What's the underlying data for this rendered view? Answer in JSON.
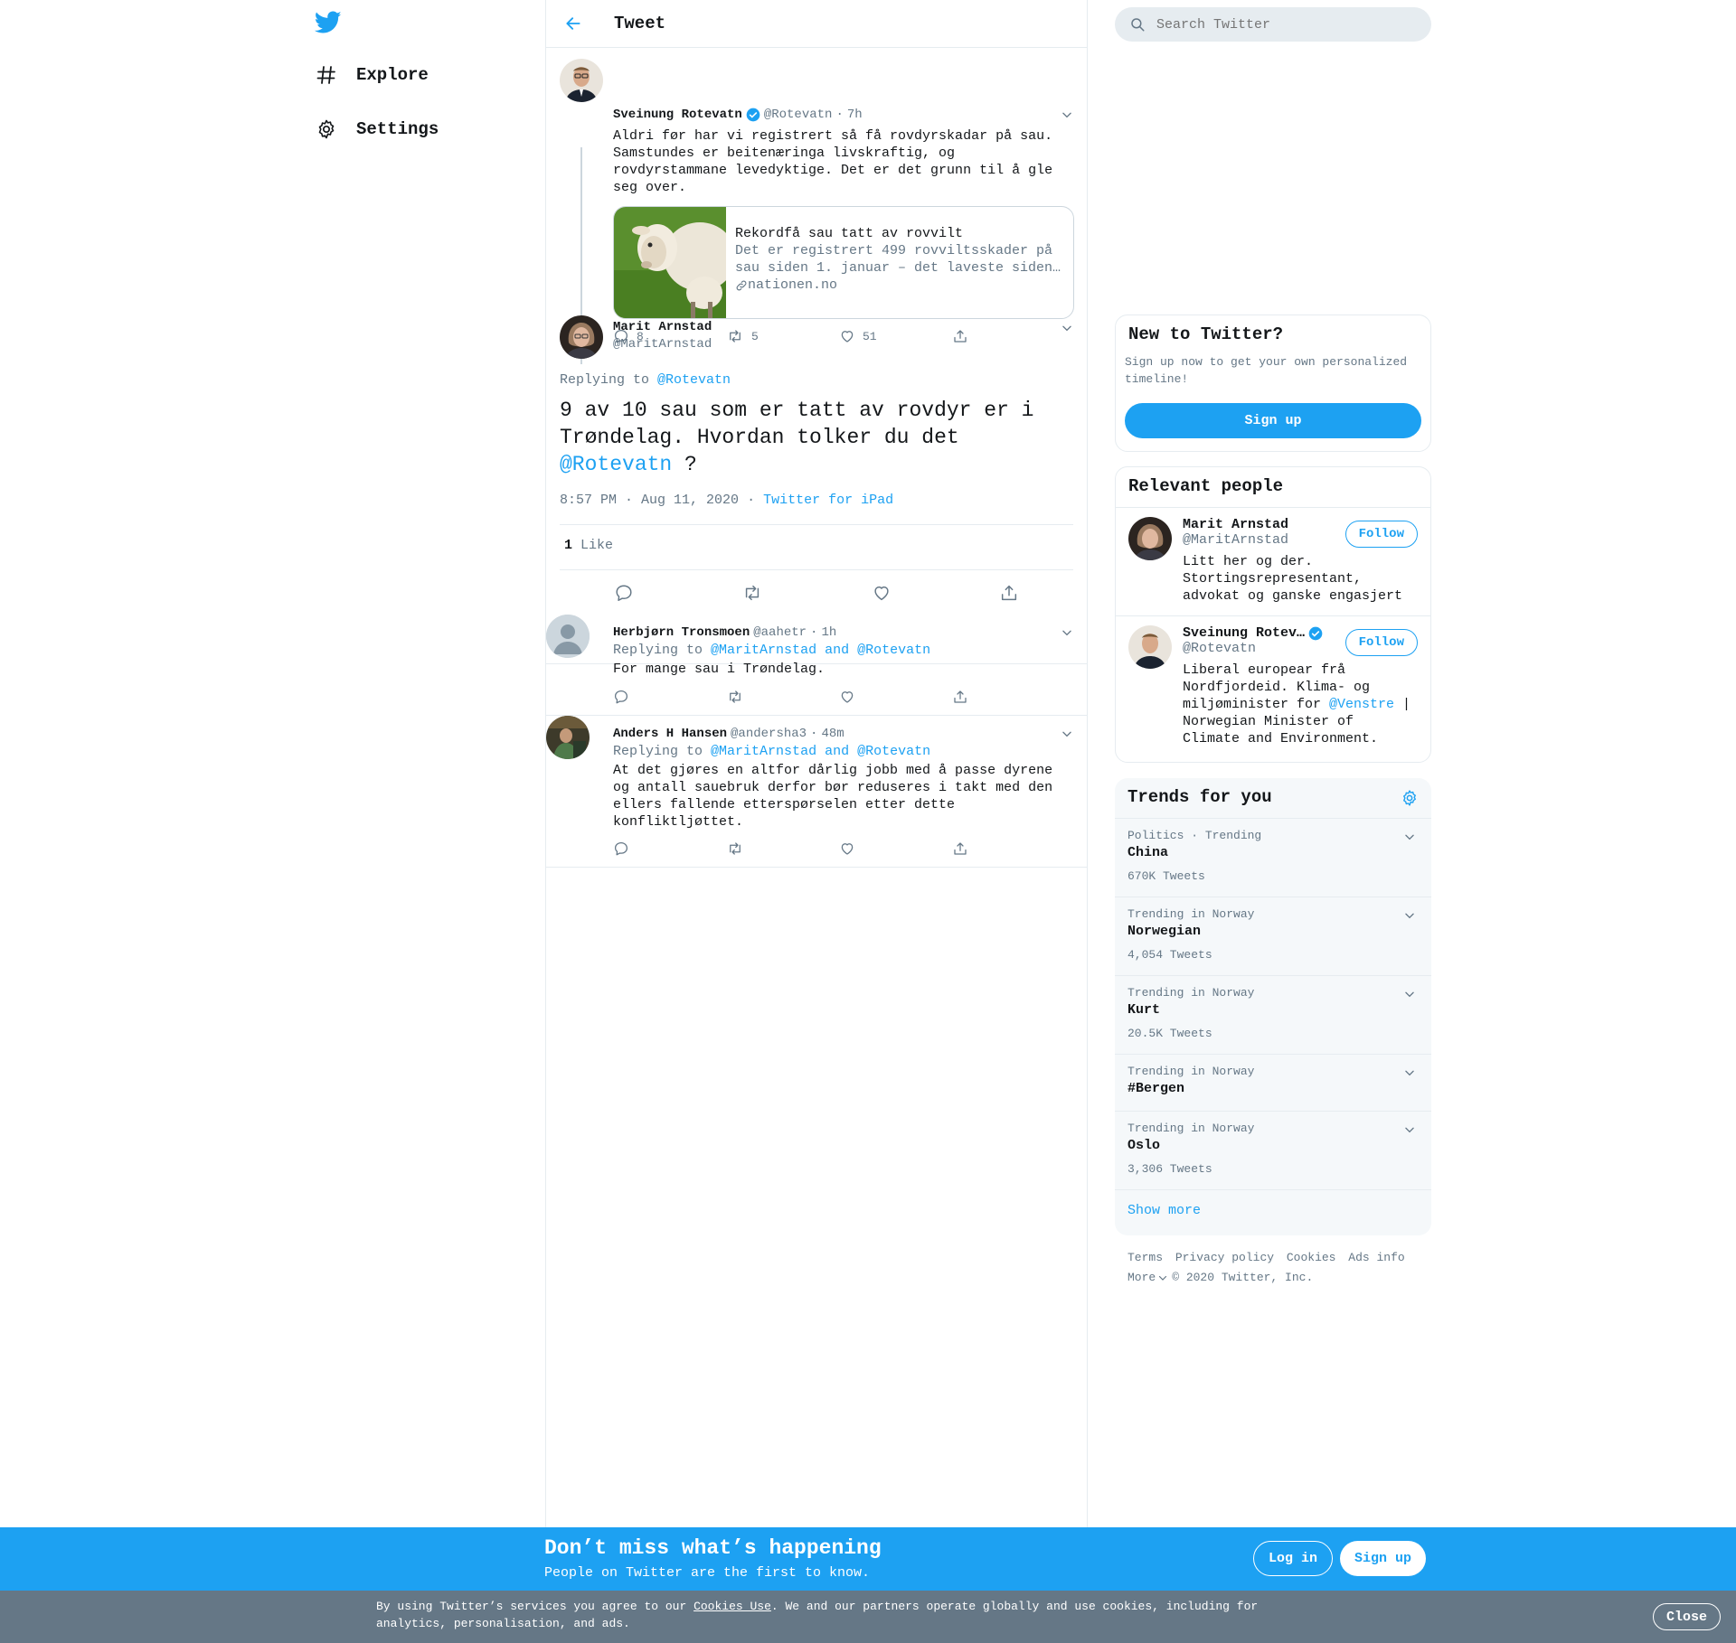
{
  "colors": {
    "accent": "#1da1f2",
    "muted": "#657786",
    "text": "#14171a",
    "border": "#e6ecf0",
    "cookie_bar": "#657786"
  },
  "nav": {
    "logo_icon": "twitter-bird-icon",
    "items": [
      {
        "label": "Explore",
        "icon": "hashtag-icon"
      },
      {
        "label": "Settings",
        "icon": "gear-icon"
      }
    ]
  },
  "header": {
    "title": "Tweet"
  },
  "parent_tweet": {
    "name": "Sveinung Rotevatn",
    "handle": "@Rotevatn",
    "separator": "·",
    "time": "7h",
    "text": "Aldri før har vi registrert så få rovdyrskadar på sau.\nSamstundes er beitenæringa livskraftig, og\nrovdyrstammane levedyktige. Det er det grunn til å gle\nseg over.",
    "card": {
      "title": "Rekordfå sau tatt av rovvilt",
      "description": "Det er registrert 499 rovviltsskader på\nsau siden 1. januar – det laveste siden…",
      "domain": "nationen.no"
    },
    "replies": "8",
    "retweets": "5",
    "likes": "51"
  },
  "focal_tweet": {
    "name": "Marit Arnstad",
    "handle": "@MaritArnstad",
    "replying_label": "Replying to",
    "replying_to": "@Rotevatn",
    "text_before": "9 av 10 sau som er tatt av rovdyr er i\nTrøndelag. Hvordan tolker du det\n",
    "mention": "@Rotevatn",
    "text_after": " ?",
    "time": "8:57 PM · Aug 11, 2020",
    "separator": "·",
    "source": "Twitter for iPad",
    "like_count": "1",
    "like_label": "Like"
  },
  "replies": [
    {
      "name": "Herbjørn Tronsmoen",
      "handle": "@aahetr",
      "separator": "·",
      "time": "1h",
      "replying_label": "Replying to",
      "replying_to": "@MaritArnstad and @Rotevatn",
      "text": "For mange sau i Trøndelag."
    },
    {
      "name": "Anders H Hansen",
      "handle": "@andersha3",
      "separator": "·",
      "time": "48m",
      "replying_label": "Replying to",
      "replying_to": "@MaritArnstad and @Rotevatn",
      "text": "At det gjøres en altfor dårlig jobb med å passe dyrene\nog antall sauebruk derfor bør reduseres i takt med den\nellers fallende etterspørselen etter dette\nkonfliktljøttet."
    }
  ],
  "search": {
    "placeholder": "Search Twitter"
  },
  "new_to_twitter": {
    "title": "New to Twitter?",
    "text": "Sign up now to get your own personalized\ntimeline!",
    "button": "Sign up"
  },
  "relevant_people": {
    "title": "Relevant people",
    "people": [
      {
        "name": "Marit Arnstad",
        "handle": "@MaritArnstad",
        "bio": "Litt her og der.\nStortingsrepresentant,\nadvokat og ganske engasjert",
        "follow": "Follow"
      },
      {
        "name": "Sveinung Rotev…",
        "handle": "@Rotevatn",
        "bio_before": "Liberal europear frå\nNordfjordeid. Klima- og\nmiljøminister for ",
        "bio_mention": "@Venstre",
        "bio_after": " |\nNorwegian Minister of\nClimate and Environment.",
        "follow": "Follow"
      }
    ]
  },
  "trends": {
    "title": "Trends for you",
    "items": [
      {
        "category": "Politics · Trending",
        "name": "China",
        "count": "670K Tweets"
      },
      {
        "category": "Trending in Norway",
        "name": "Norwegian",
        "count": "4,054 Tweets"
      },
      {
        "category": "Trending in Norway",
        "name": "Kurt",
        "count": "20.5K Tweets"
      },
      {
        "category": "Trending in Norway",
        "name": "#Bergen",
        "count": ""
      },
      {
        "category": "Trending in Norway",
        "name": "Oslo",
        "count": "3,306 Tweets"
      }
    ],
    "show_more": "Show more"
  },
  "footer": {
    "links": [
      "Terms",
      "Privacy policy",
      "Cookies",
      "Ads info"
    ],
    "more": "More",
    "copyright": "© 2020 Twitter, Inc."
  },
  "bottom_bar": {
    "headline": "Don’t miss what’s happening",
    "subline": "People on Twitter are the first to know.",
    "login": "Log in",
    "signup": "Sign up"
  },
  "cookie_bar": {
    "text_before": "By using Twitter’s services you agree to our ",
    "link": "Cookies Use",
    "text_after": ". We and our partners operate globally and use cookies, including for analytics, personalisation, and ads.",
    "close": "Close"
  }
}
